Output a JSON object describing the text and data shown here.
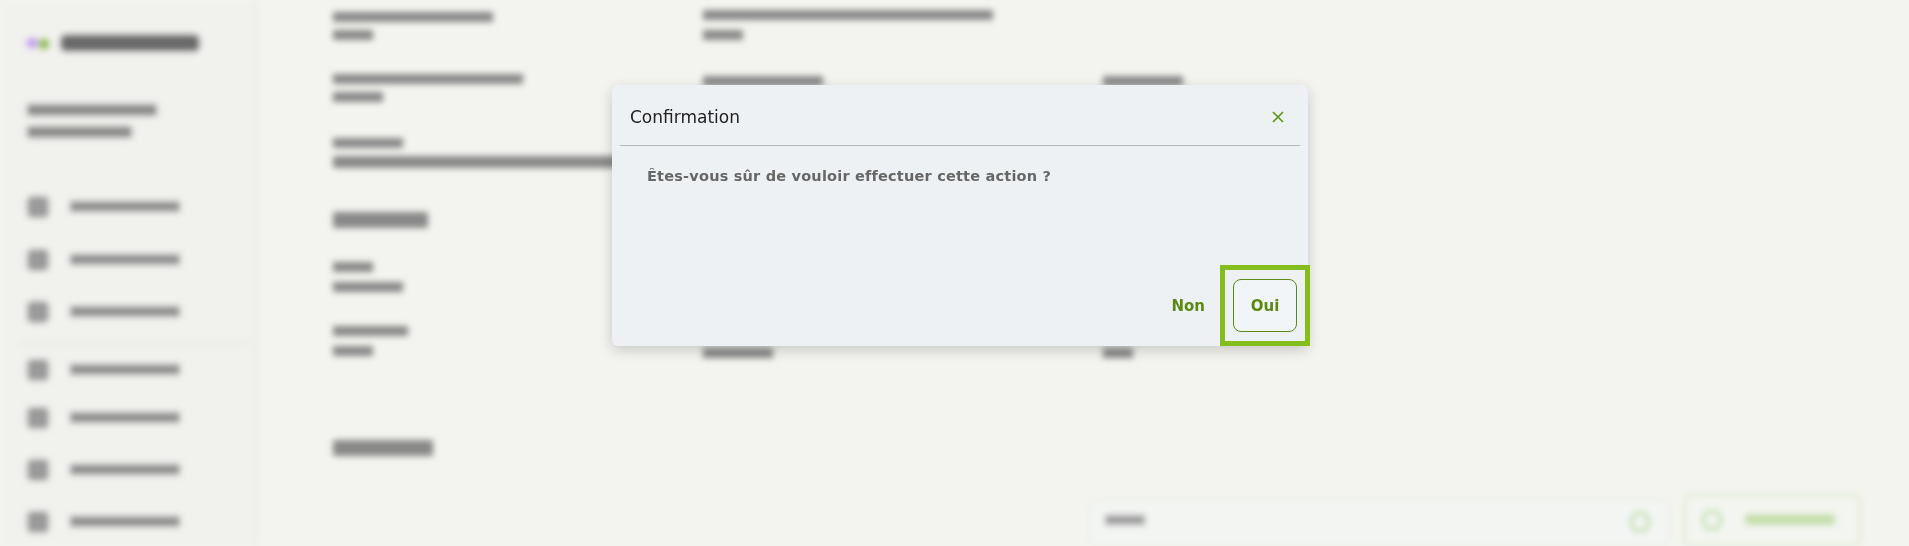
{
  "dialog": {
    "title": "Confirmation",
    "message": "Êtes-vous sûr de vouloir effectuer cette action ?",
    "buttons": [
      {
        "label": "Non",
        "kind": "text",
        "focused": false
      },
      {
        "label": "Oui",
        "kind": "outlined",
        "focused": true
      }
    ]
  }
}
